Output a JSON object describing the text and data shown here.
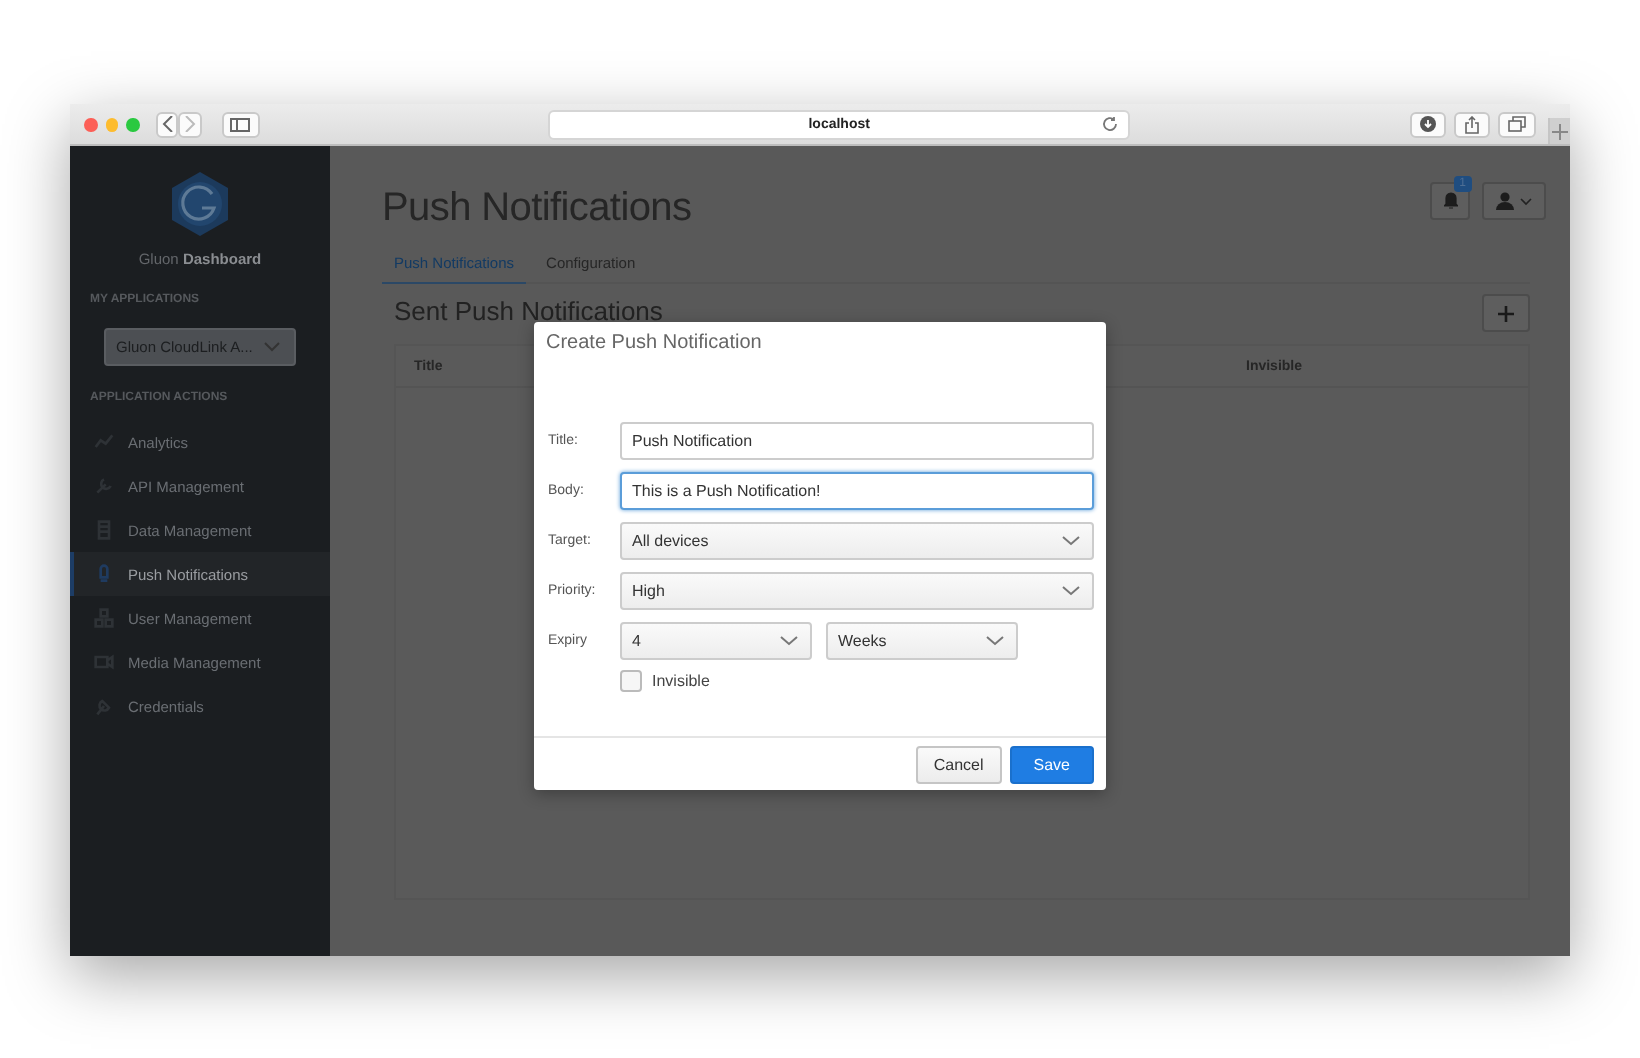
{
  "browser": {
    "url": "localhost"
  },
  "sidebar": {
    "brand_prefix": "Gluon",
    "brand_name": "Dashboard",
    "apps_heading": "MY APPLICATIONS",
    "app_select": "Gluon CloudLink A...",
    "actions_heading": "APPLICATION ACTIONS",
    "items": [
      {
        "label": "Analytics",
        "selected": false
      },
      {
        "label": "API Management",
        "selected": false
      },
      {
        "label": "Data Management",
        "selected": false
      },
      {
        "label": "Push Notifications",
        "selected": true
      },
      {
        "label": "User Management",
        "selected": false
      },
      {
        "label": "Media Management",
        "selected": false
      },
      {
        "label": "Credentials",
        "selected": false
      }
    ]
  },
  "header": {
    "title": "Push Notifications",
    "notification_count": "1",
    "tabs": [
      {
        "label": "Push Notifications",
        "selected": true
      },
      {
        "label": "Configuration",
        "selected": false
      }
    ]
  },
  "section_title": "Sent Push Notifications",
  "table": {
    "columns": [
      "Title",
      "Invisible"
    ]
  },
  "dialog": {
    "title": "Create Push Notification",
    "fields": [
      {
        "label": "Title:",
        "kind": "text",
        "value": "Push Notification",
        "focused": false
      },
      {
        "label": "Body:",
        "kind": "text",
        "value": "This is a Push Notification!",
        "focused": true
      },
      {
        "label": "Target:",
        "kind": "select",
        "value": "All devices"
      },
      {
        "label": "Priority:",
        "kind": "select",
        "value": "High"
      }
    ],
    "expiry": {
      "label": "Expiry",
      "amount": "4",
      "unit": "Weeks"
    },
    "invisible": {
      "label": "Invisible",
      "checked": false
    },
    "buttons": [
      {
        "label": "Cancel",
        "kind": "secondary"
      },
      {
        "label": "Save",
        "kind": "primary"
      }
    ]
  }
}
